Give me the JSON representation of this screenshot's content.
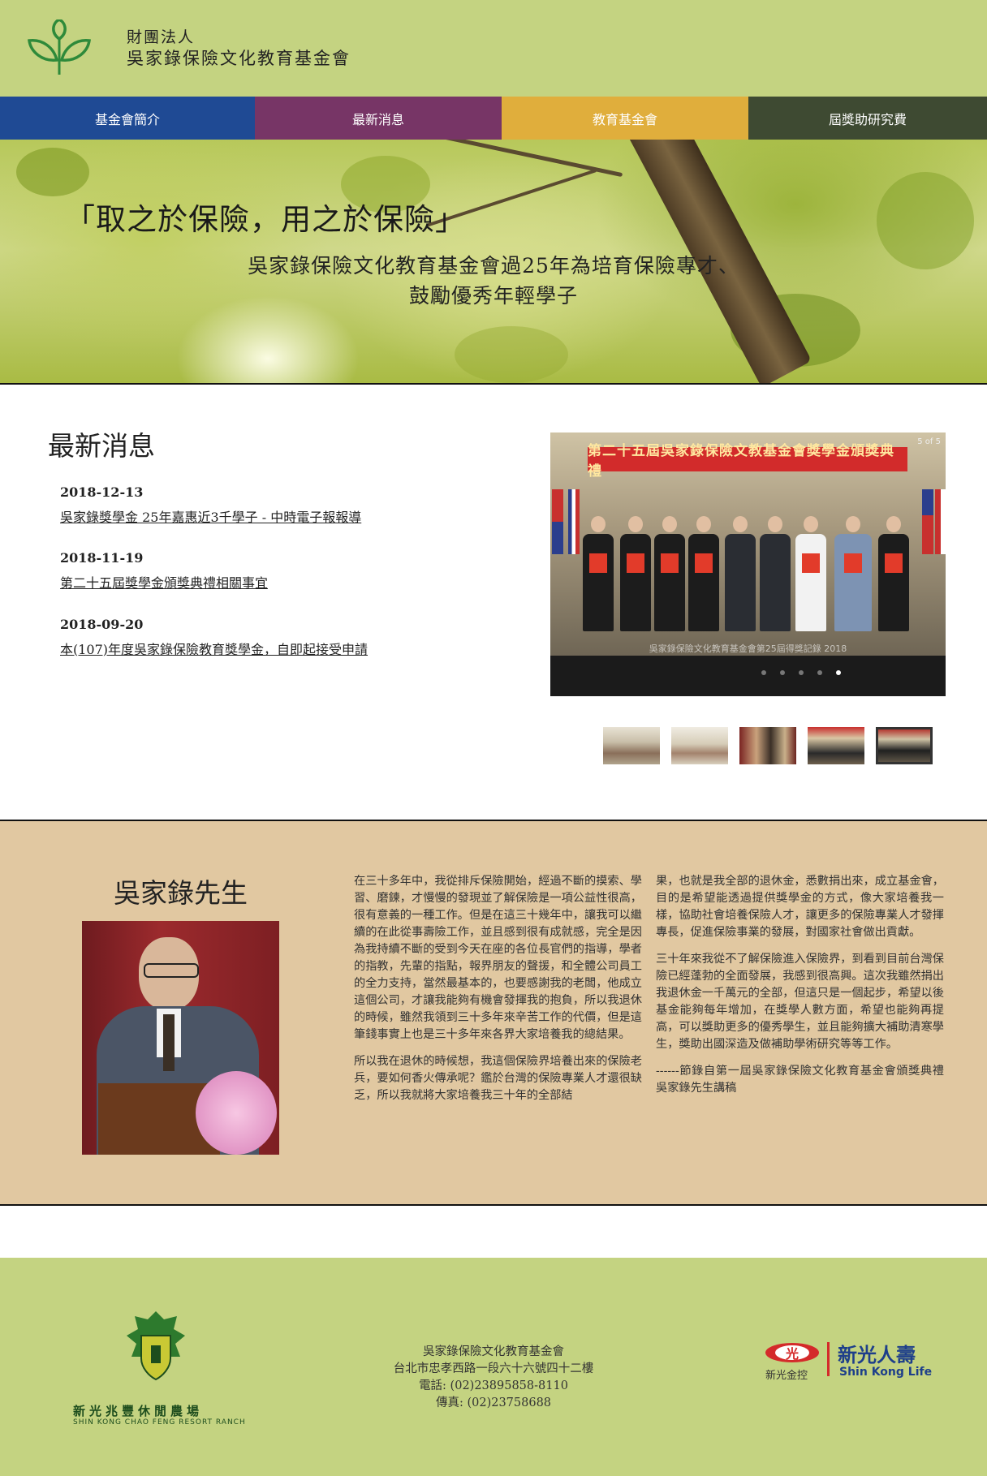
{
  "header": {
    "org_sub": "財團法人",
    "org_name": "吳家錄保險文化教育基金會"
  },
  "nav": {
    "items": [
      {
        "label": "基金會簡介",
        "color": "#1f4a94"
      },
      {
        "label": "最新消息",
        "color": "#773566"
      },
      {
        "label": "教育基金會",
        "color": "#e0ae3c"
      },
      {
        "label": "屆獎助研究費",
        "color": "#3e4a32"
      }
    ]
  },
  "hero": {
    "quote": "「取之於保險，用之於保險」",
    "sub1": "吳家錄保險文化教育基金會過25年為培育保險專才、",
    "sub2": "鼓勵優秀年輕學子"
  },
  "news": {
    "title": "最新消息",
    "items": [
      {
        "date": "2018-12-13",
        "title": "吳家錄獎學金 25年嘉惠近3千學子 - 中時電子報報導"
      },
      {
        "date": "2018-11-19",
        "title": "第二十五屆獎學金頒獎典禮相關事宜"
      },
      {
        "date": "2018-09-20",
        "title": "本(107)年度吳家錄保險教育獎學金，自即起接受申請"
      }
    ]
  },
  "slideshow": {
    "counter": "5 of 5",
    "banner": "第二十五屆吳家錄保險文教基金會獎學金頒獎典禮",
    "caption": "吳家錄保險文化教育基金會第25屆得獎記錄 2018",
    "total": 5,
    "active_index": 4
  },
  "founder": {
    "name": "吳家錄先生",
    "col1_p1": "在三十多年中，我從排斥保險開始，經過不斷的摸索、學習、磨鍊，才慢慢的發現並了解保險是一項公益性很高，很有意義的一種工作。但是在這三十幾年中，讓我可以繼續的在此從事壽險工作，並且感到很有成就感，完全是因為我持續不斷的受到今天在座的各位長官們的指導，學者的指教，先輩的指點，報界朋友的聲援，和全體公司員工的全力支持，當然最基本的，也要感謝我的老闆，他成立這個公司，才讓我能夠有機會發揮我的抱負，所以我退休的時候，雖然我領到三十多年來辛苦工作的代價，但是這筆錢事實上也是三十多年來各界大家培養我的總結果。",
    "col1_p2": "所以我在退休的時候想，我這個保險界培養出來的保險老兵，要如何香火傳承呢？鑑於台灣的保險專業人才還很缺乏，所以我就將大家培養我三十年的全部結",
    "col2_p1": "果，也就是我全部的退休金，悉數捐出來，成立基金會，目的是希望能透過提供獎學金的方式，像大家培養我一樣，協助社會培養保險人才，讓更多的保險專業人才發揮專長，促進保險事業的發展，對國家社會做出貢獻。",
    "col2_p2": "三十年來我從不了解保險進入保險界，到看到目前台灣保險已經蓬勃的全面發展，我感到很高興。這次我雖然捐出我退休金一千萬元的全部，但這只是一個起步，希望以後基金能夠每年增加，在獎學人數方面，希望也能夠再提高，可以獎助更多的優秀學生，並且能夠擴大補助清寒學生，獎助出國深造及做補助學術研究等等工作。",
    "col2_p3": "------節錄自第一屆吳家錄保險文化教育基金會頒獎典禮吳家錄先生講稿"
  },
  "footer": {
    "org": "吳家錄保險文化教育基金會",
    "address": "台北市忠孝西路一段六十六號四十二樓",
    "phone": "電話: (02)23895858-8110",
    "fax": "傳真: (02)23758688",
    "ranch_cn": "新光兆豐休閒農場",
    "ranch_en": "SHIN KONG CHAO FENG RESORT RANCH",
    "sk_badge": "光",
    "sk_holdings": "新光金控",
    "sk_life_cn": "新光人壽",
    "sk_life_en": "Shin Kong Life"
  }
}
